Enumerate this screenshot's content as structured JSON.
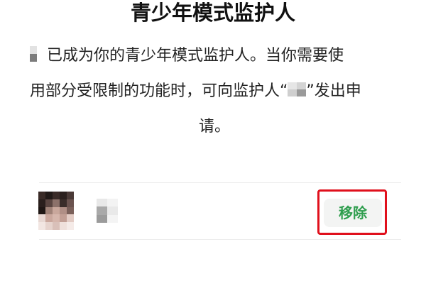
{
  "page": {
    "title": "青少年模式监护人"
  },
  "description": {
    "line1_text": "已成为你的青少年模式监护人。当你需要使",
    "line2_prefix": "用部分受限制的功能时，可向监护人“",
    "line2_suffix": "”发出申",
    "line3_text": "请。"
  },
  "guardian": {
    "remove_label": "移除"
  },
  "colors": {
    "accent_green": "#2f9e4e",
    "highlight_red": "#e0101c",
    "button_bg": "#f3f4f3"
  },
  "icons": {
    "avatar": "pixelated-avatar-image",
    "name": "pixelated-name"
  }
}
